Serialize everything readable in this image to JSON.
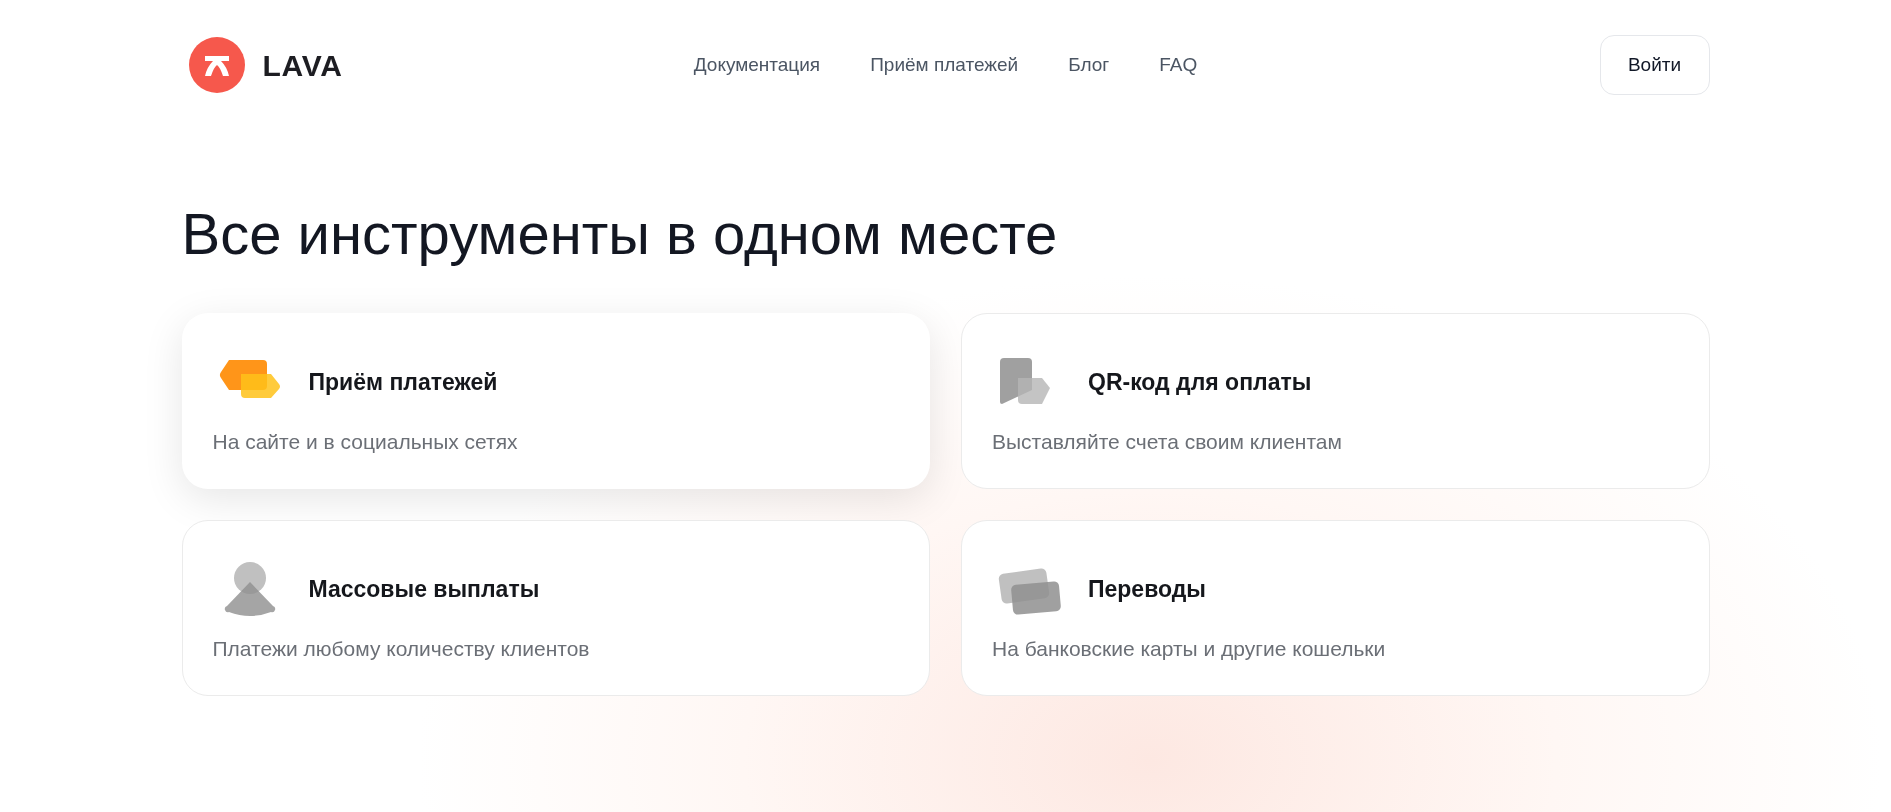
{
  "header": {
    "logo": "LAVA",
    "nav": [
      "Документация",
      "Приём платежей",
      "Блог",
      "FAQ"
    ],
    "login_button": "Войти"
  },
  "heading": "Все инструменты в одном месте",
  "cards": [
    {
      "kind": "payments",
      "title": "Приём платежей",
      "subtitle": "На сайте и в социальных сетях",
      "selected": true
    },
    {
      "kind": "qr",
      "title": "QR-код для оплаты",
      "subtitle": "Выставляйте счета своим клиентам",
      "selected": false
    },
    {
      "kind": "payouts",
      "title": "Массовые выплаты",
      "subtitle": "Платежи любому количеству клиентов",
      "selected": false
    },
    {
      "kind": "transfers",
      "title": "Переводы",
      "subtitle": "На банковские карты и другие кошельки",
      "selected": false
    }
  ]
}
